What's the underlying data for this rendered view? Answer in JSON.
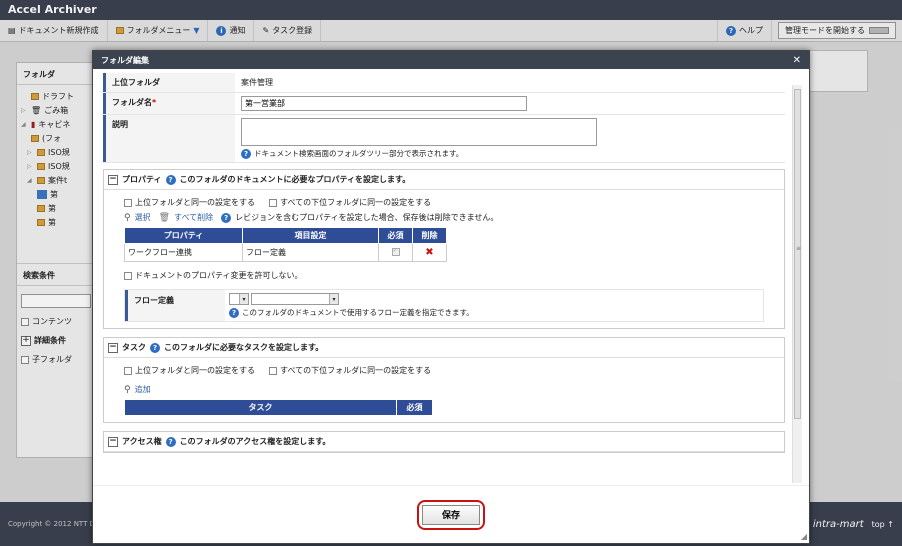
{
  "app": {
    "title": "Accel Archiver",
    "toolbar": {
      "new_document": "ドキュメント新規作成",
      "folder_menu": "フォルダメニュー",
      "notify": "通知",
      "task_register": "タスク登録",
      "help": "ヘルプ",
      "admin_mode": "管理モードを開始する"
    },
    "left_panel": {
      "title": "フォルダ",
      "tree": [
        "ドラフト",
        "ごみ箱",
        "キャビネ",
        "(フォ",
        "ISO規",
        "ISO規",
        "案件t",
        "第",
        "第",
        "第"
      ],
      "search_title": "検索条件",
      "content_label": "コンテンツ",
      "detail_label": "詳細条件",
      "subfolder_label": "子フォルダ"
    },
    "footer": {
      "copyright": "Copyright © 2012 NTT Da",
      "logo": "intra-mart",
      "top": "top ↑"
    }
  },
  "modal": {
    "title": "フォルダ編集",
    "parent_folder_label": "上位フォルダ",
    "parent_folder_value": "案件管理",
    "folder_name_label": "フォルダ名",
    "required_mark": "*",
    "folder_name_value": "第一営業部",
    "description_label": "説明",
    "description_value": "",
    "description_hint": "ドキュメント検索画面のフォルダツリー部分で表示されます。",
    "property": {
      "title": "プロパティ",
      "desc": "このフォルダのドキュメントに必要なプロパティを設定します。",
      "same_as_parent": "上位フォルダと同一の設定をする",
      "same_for_children": "すべての下位フォルダに同一の設定をする",
      "select_link": "選択",
      "delete_all_link": "すべて削除",
      "note": "レビジョンを含むプロパティを設定した場合、保存後は削除できません。",
      "columns": [
        "プロパティ",
        "項目設定",
        "必須",
        "削除"
      ],
      "rows": [
        {
          "property": "ワークフロー連携",
          "setting": "フロー定義"
        }
      ],
      "disallow_change": "ドキュメントのプロパティ変更を許可しない。",
      "flow_label": "フロー定義",
      "flow_hint": "このフォルダのドキュメントで使用するフロー定義を指定できます。"
    },
    "task": {
      "title": "タスク",
      "desc": "このフォルダに必要なタスクを設定します。",
      "same_as_parent": "上位フォルダと同一の設定をする",
      "same_for_children": "すべての下位フォルダに同一の設定をする",
      "add_link": "追加",
      "columns": [
        "タスク",
        "必須"
      ]
    },
    "access": {
      "title": "アクセス権",
      "desc": "このフォルダのアクセス権を設定します。"
    },
    "save_label": "保存"
  }
}
